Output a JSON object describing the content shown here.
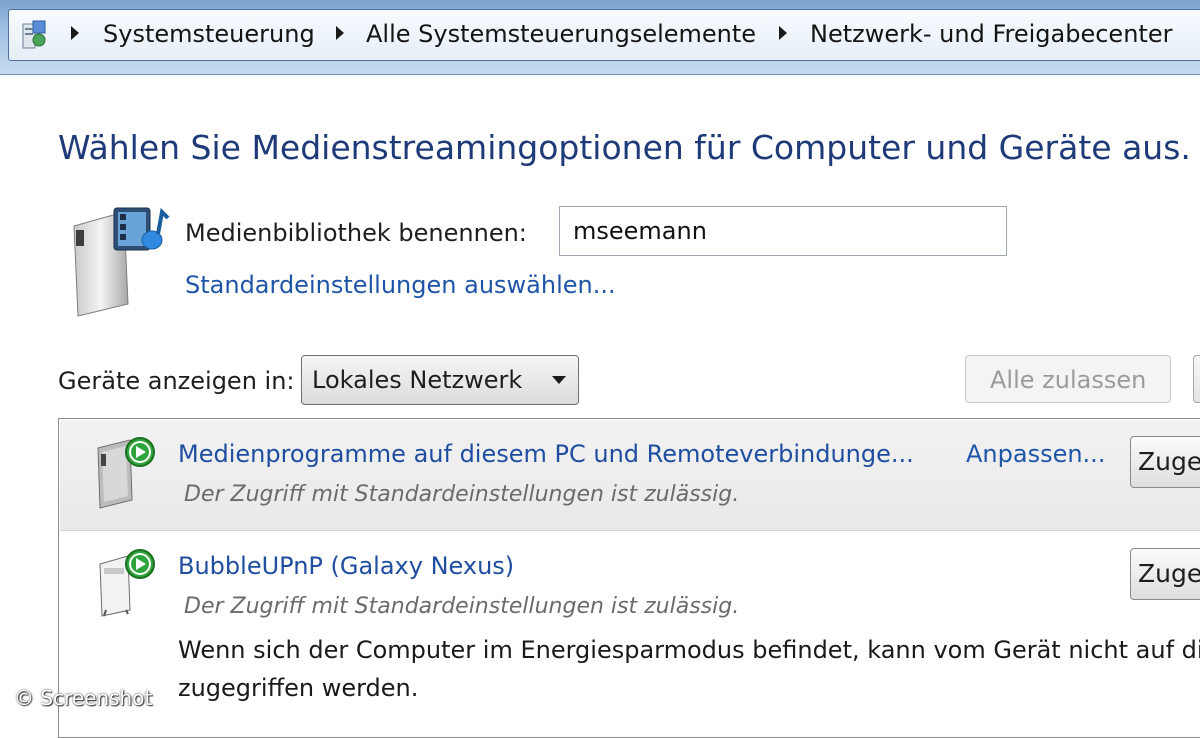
{
  "breadcrumb": {
    "items": [
      "Systemsteuerung",
      "Alle Systemsteuerungselemente",
      "Netzwerk- und Freigabecenter"
    ]
  },
  "page": {
    "title": "Wählen Sie Medienstreamingoptionen für Computer und Geräte aus."
  },
  "library": {
    "name_label": "Medienbibliothek benennen:",
    "name_value": "mseemann",
    "defaults_link": "Standardeinstellungen auswählen..."
  },
  "filter": {
    "label": "Geräte anzeigen in:",
    "selected": "Lokales Netzwerk",
    "allow_all_button": "Alle zulassen"
  },
  "devices": [
    {
      "name": "Medienprogramme auf diesem PC und Remoteverbindunge...",
      "customize_link": "Anpassen...",
      "status": "Der Zugriff mit Standardeinstellungen ist zulässig.",
      "access_button": "Zugelassen"
    },
    {
      "name": "BubbleUPnP (Galaxy Nexus)",
      "status": "Der Zugriff mit Standardeinstellungen ist zulässig.",
      "note_line1": "Wenn sich der Computer im Energiesparmodus befindet, kann vom Gerät nicht auf die",
      "note_line2": "zugegriffen werden.",
      "access_button": "Zugelassen"
    }
  ],
  "watermark": "© Screenshot",
  "colors": {
    "heading": "#1e3a78",
    "link": "#1f55a8",
    "addressbar": "#9fc0e3",
    "status_green": "#2fa43a"
  }
}
